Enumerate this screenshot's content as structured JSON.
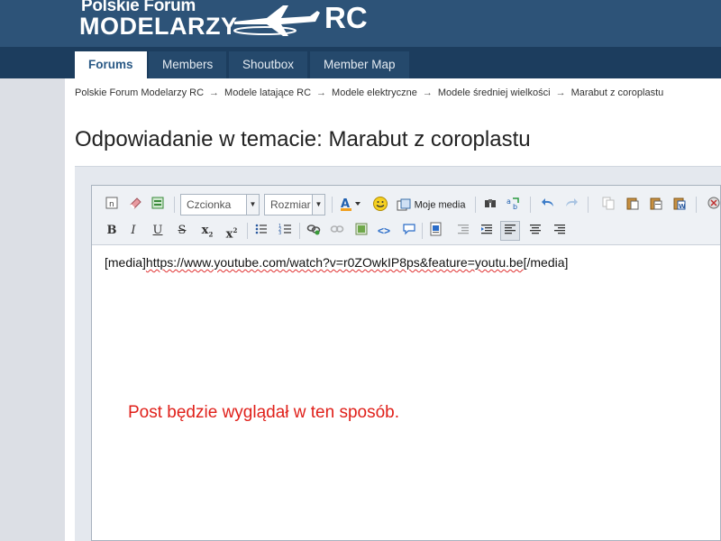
{
  "header": {
    "logo_top": "Polskie Forum",
    "logo_bottom": "Modelarzy",
    "logo_rc": "RC"
  },
  "nav": {
    "tabs": [
      {
        "label": "Forums",
        "active": true
      },
      {
        "label": "Members",
        "active": false
      },
      {
        "label": "Shoutbox",
        "active": false
      },
      {
        "label": "Member Map",
        "active": false
      }
    ]
  },
  "breadcrumb": {
    "items": [
      "Polskie Forum Modelarzy RC",
      "Modele latające RC",
      "Modele elektryczne",
      "Modele średniej wielkości",
      "Marabut z coroplastu"
    ],
    "separator": "→"
  },
  "page": {
    "title": "Odpowiadanie w temacie: Marabut z coroplastu"
  },
  "editor": {
    "font_select": "Czcionka",
    "size_select": "Rozmiar",
    "media_button": "Moje media",
    "content_prefix": "[media]",
    "content_url": "https://www.youtube.com/watch?v=r0ZOwkIP8ps&feature=youtu.be",
    "content_suffix": "[/media]"
  },
  "note": "Post będzie wyglądał w ten sposób.",
  "colors": {
    "header_bg": "#2d5378",
    "nav_bg": "#1c3d5e",
    "note_red": "#e0201a"
  }
}
